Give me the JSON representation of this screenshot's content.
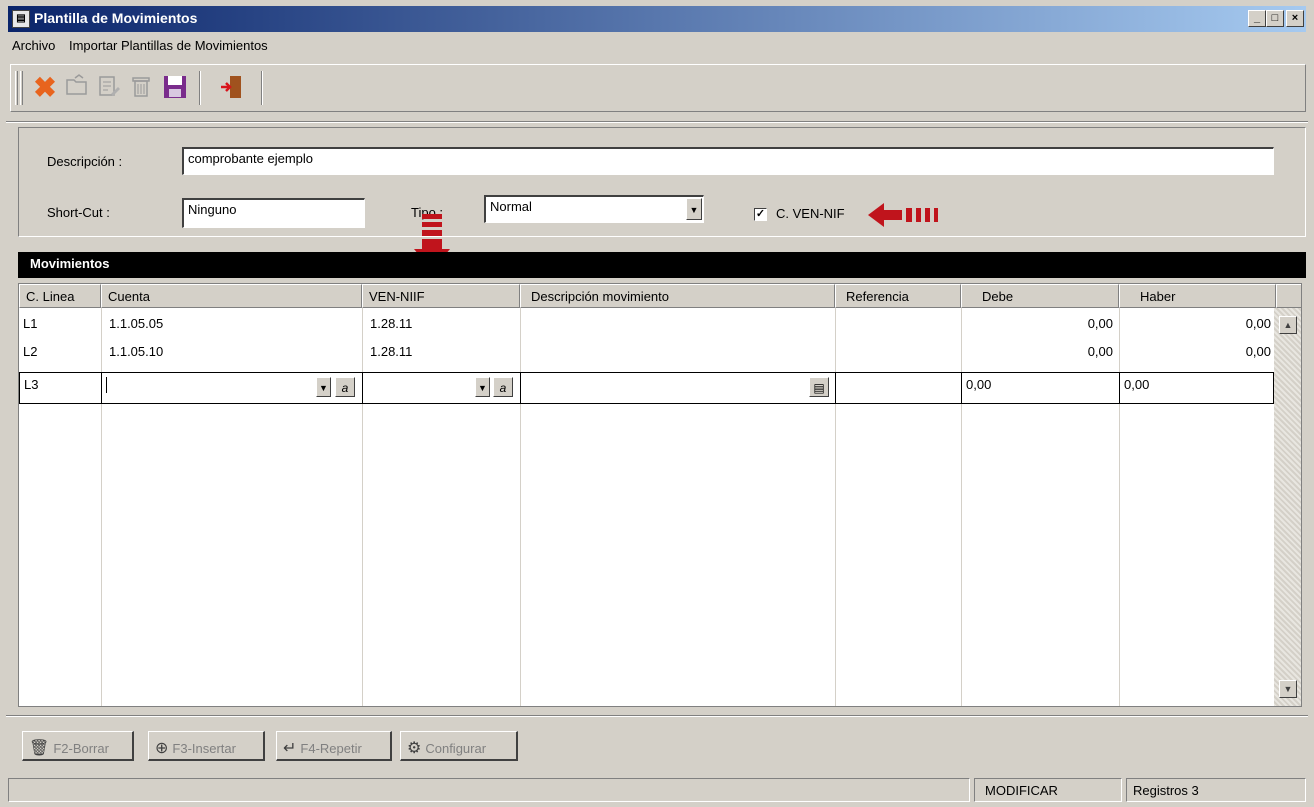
{
  "window": {
    "title": "Plantilla de Movimientos",
    "controls": {
      "minimize": "_",
      "maximize": "□",
      "close": "×"
    }
  },
  "menu": {
    "items": [
      "Archivo",
      "Importar Plantillas de Movimientos"
    ]
  },
  "toolbar": {
    "icons": [
      "delete-icon",
      "open-icon",
      "edit-icon",
      "trash-icon",
      "save-icon",
      "exit-icon"
    ]
  },
  "form": {
    "descripcion_label": "Descripción :",
    "descripcion_value": "comprobante ejemplo",
    "shortcut_label": "Short-Cut :",
    "shortcut_value": "Ninguno",
    "tipo_label": "Tipo :",
    "tipo_value": "Normal",
    "checkbox_label": "C. VEN-NIF",
    "checkbox_checked": true
  },
  "section": {
    "title": "Movimientos"
  },
  "grid": {
    "columns": [
      "C. Linea",
      "Cuenta",
      "VEN-NIIF",
      "Descripción movimiento",
      "Referencia",
      "Debe",
      "Haber"
    ],
    "rows": [
      {
        "linea": "L1",
        "cuenta": "1.1.05.05",
        "ven_niif": "1.28.11",
        "descripcion": "",
        "referencia": "",
        "debe": "0,00",
        "haber": "0,00"
      },
      {
        "linea": "L2",
        "cuenta": "1.1.05.10",
        "ven_niif": "1.28.11",
        "descripcion": "",
        "referencia": "",
        "debe": "0,00",
        "haber": "0,00"
      }
    ],
    "edit_row": {
      "linea": "L3",
      "cuenta": "",
      "ven_niif": "",
      "descripcion": "",
      "referencia": "",
      "debe": "0,00",
      "haber": "0,00"
    }
  },
  "actions": {
    "borrar": "F2-Borrar",
    "insertar": "F3-Insertar",
    "repetir": "F4-Repetir",
    "configurar": "Configurar"
  },
  "status": {
    "mode": "MODIFICAR",
    "records": "Registros 3"
  },
  "colors": {
    "title_start": "#0a246a",
    "title_end": "#a6caf0",
    "annotation_arrow": "#c0141c",
    "face": "#d4d0c8"
  }
}
